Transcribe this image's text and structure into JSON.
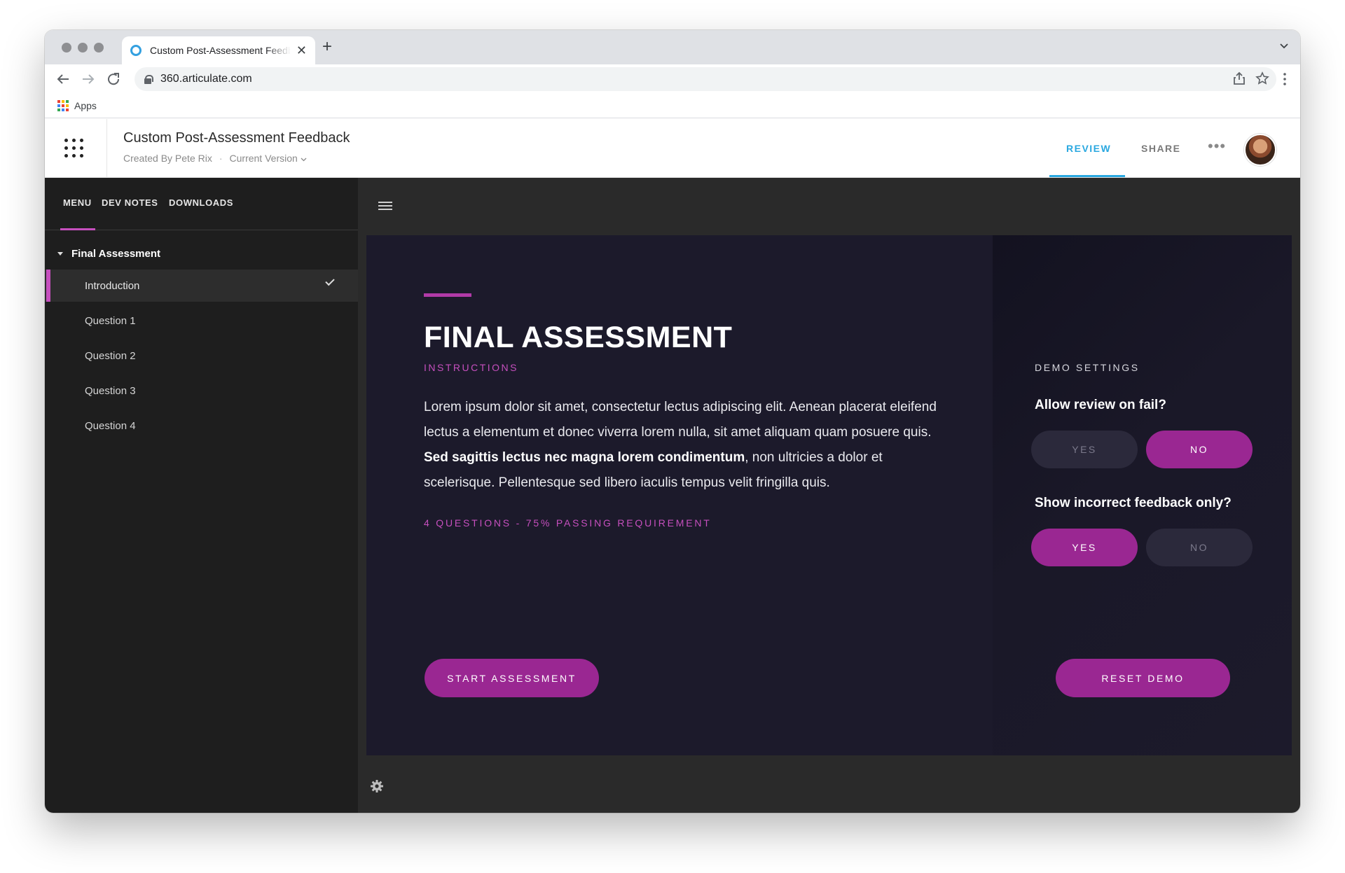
{
  "browser": {
    "tab_title": "Custom Post-Assessment Feedback",
    "url": "360.articulate.com",
    "bookmarks_apps_label": "Apps",
    "icons": [
      "back-icon",
      "forward-icon",
      "reload-icon",
      "lock-icon",
      "share-icon",
      "star-icon",
      "kebab-icon"
    ]
  },
  "header": {
    "title": "Custom Post-Assessment Feedback",
    "created_by": "Created By Pete Rix",
    "separator": "·",
    "version": "Current Version",
    "tabs": [
      {
        "label": "REVIEW",
        "active": true
      },
      {
        "label": "SHARE",
        "active": false
      }
    ],
    "more": "•••"
  },
  "sidebar": {
    "tabs": [
      {
        "label": "MENU",
        "active": true
      },
      {
        "label": "DEV NOTES",
        "active": false
      },
      {
        "label": "DOWNLOADS",
        "active": false
      }
    ],
    "section_title": "Final Assessment",
    "lessons": [
      {
        "label": "Introduction",
        "active": true,
        "completed": true
      },
      {
        "label": "Question 1",
        "active": false,
        "completed": false
      },
      {
        "label": "Question 2",
        "active": false,
        "completed": false
      },
      {
        "label": "Question 3",
        "active": false,
        "completed": false
      },
      {
        "label": "Question 4",
        "active": false,
        "completed": false
      }
    ]
  },
  "content": {
    "heading": "FINAL ASSESSMENT",
    "subheading": "INSTRUCTIONS",
    "body_part1": "Lorem ipsum dolor sit amet, consectetur lectus adipiscing elit. Aenean placerat eleifend lectus a elementum et donec viverra lorem nulla, sit amet aliquam quam posuere quis. ",
    "body_bold": "Sed sagittis lectus nec magna lorem condimentum",
    "body_part2": ", non ultricies a dolor et scelerisque. Pellentesque sed libero iaculis tempus velit fringilla quis.",
    "requirement": "4 QUESTIONS - 75% PASSING REQUIREMENT",
    "start_button": "START ASSESSMENT",
    "reset_button": "RESET DEMO"
  },
  "settings": {
    "heading": "DEMO SETTINGS",
    "review_question": "Allow review on fail?",
    "review_yes": "YES",
    "review_no": "NO",
    "review_selected": "NO",
    "feedback_question": "Show incorrect feedback only?",
    "feedback_yes": "YES",
    "feedback_no": "NO",
    "feedback_selected": "YES"
  },
  "colors": {
    "accent_magenta": "#9a2792",
    "accent_pink_text": "#c64fbe",
    "review_blue": "#2aa8e0",
    "stage_bg": "#1c1a2b"
  }
}
